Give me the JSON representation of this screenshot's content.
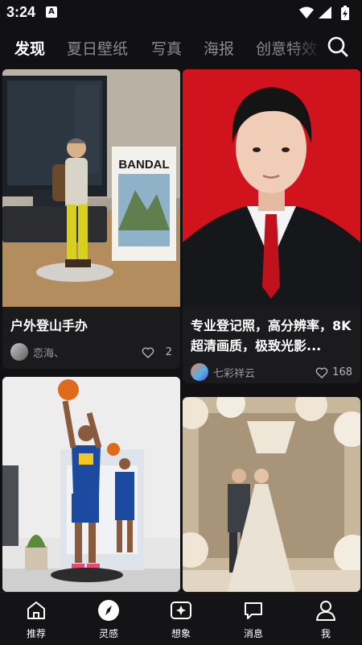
{
  "status": {
    "time": "3:24",
    "notice_glyph": "A"
  },
  "tabs": [
    {
      "label": "发现",
      "active": true
    },
    {
      "label": "夏日壁纸",
      "active": false
    },
    {
      "label": "写真",
      "active": false
    },
    {
      "label": "海报",
      "active": false
    },
    {
      "label": "创意特效",
      "active": false
    }
  ],
  "feed": [
    {
      "title": "户外登山手办",
      "author": "恋海、",
      "likes": "2",
      "image": "hiking-figurine-photo",
      "image_text": "BANDAL"
    },
    {
      "title": "专业登记照，高分辨率，8K超清画质，极致光影...",
      "author": "七彩祥云",
      "likes": "168",
      "image": "id-portrait-photo"
    },
    {
      "image": "basketball-figurine-photo"
    },
    {
      "image": "wedding-photo"
    }
  ],
  "bottom_nav": [
    {
      "label": "推荐",
      "icon": "home-icon"
    },
    {
      "label": "灵感",
      "icon": "compass-icon",
      "active": true
    },
    {
      "label": "想象",
      "icon": "sparkle-icon"
    },
    {
      "label": "消息",
      "icon": "message-icon"
    },
    {
      "label": "我",
      "icon": "profile-icon"
    }
  ],
  "colors": {
    "background": "#111113",
    "card": "#1b1b1e",
    "muted_text": "#8b8b90"
  }
}
